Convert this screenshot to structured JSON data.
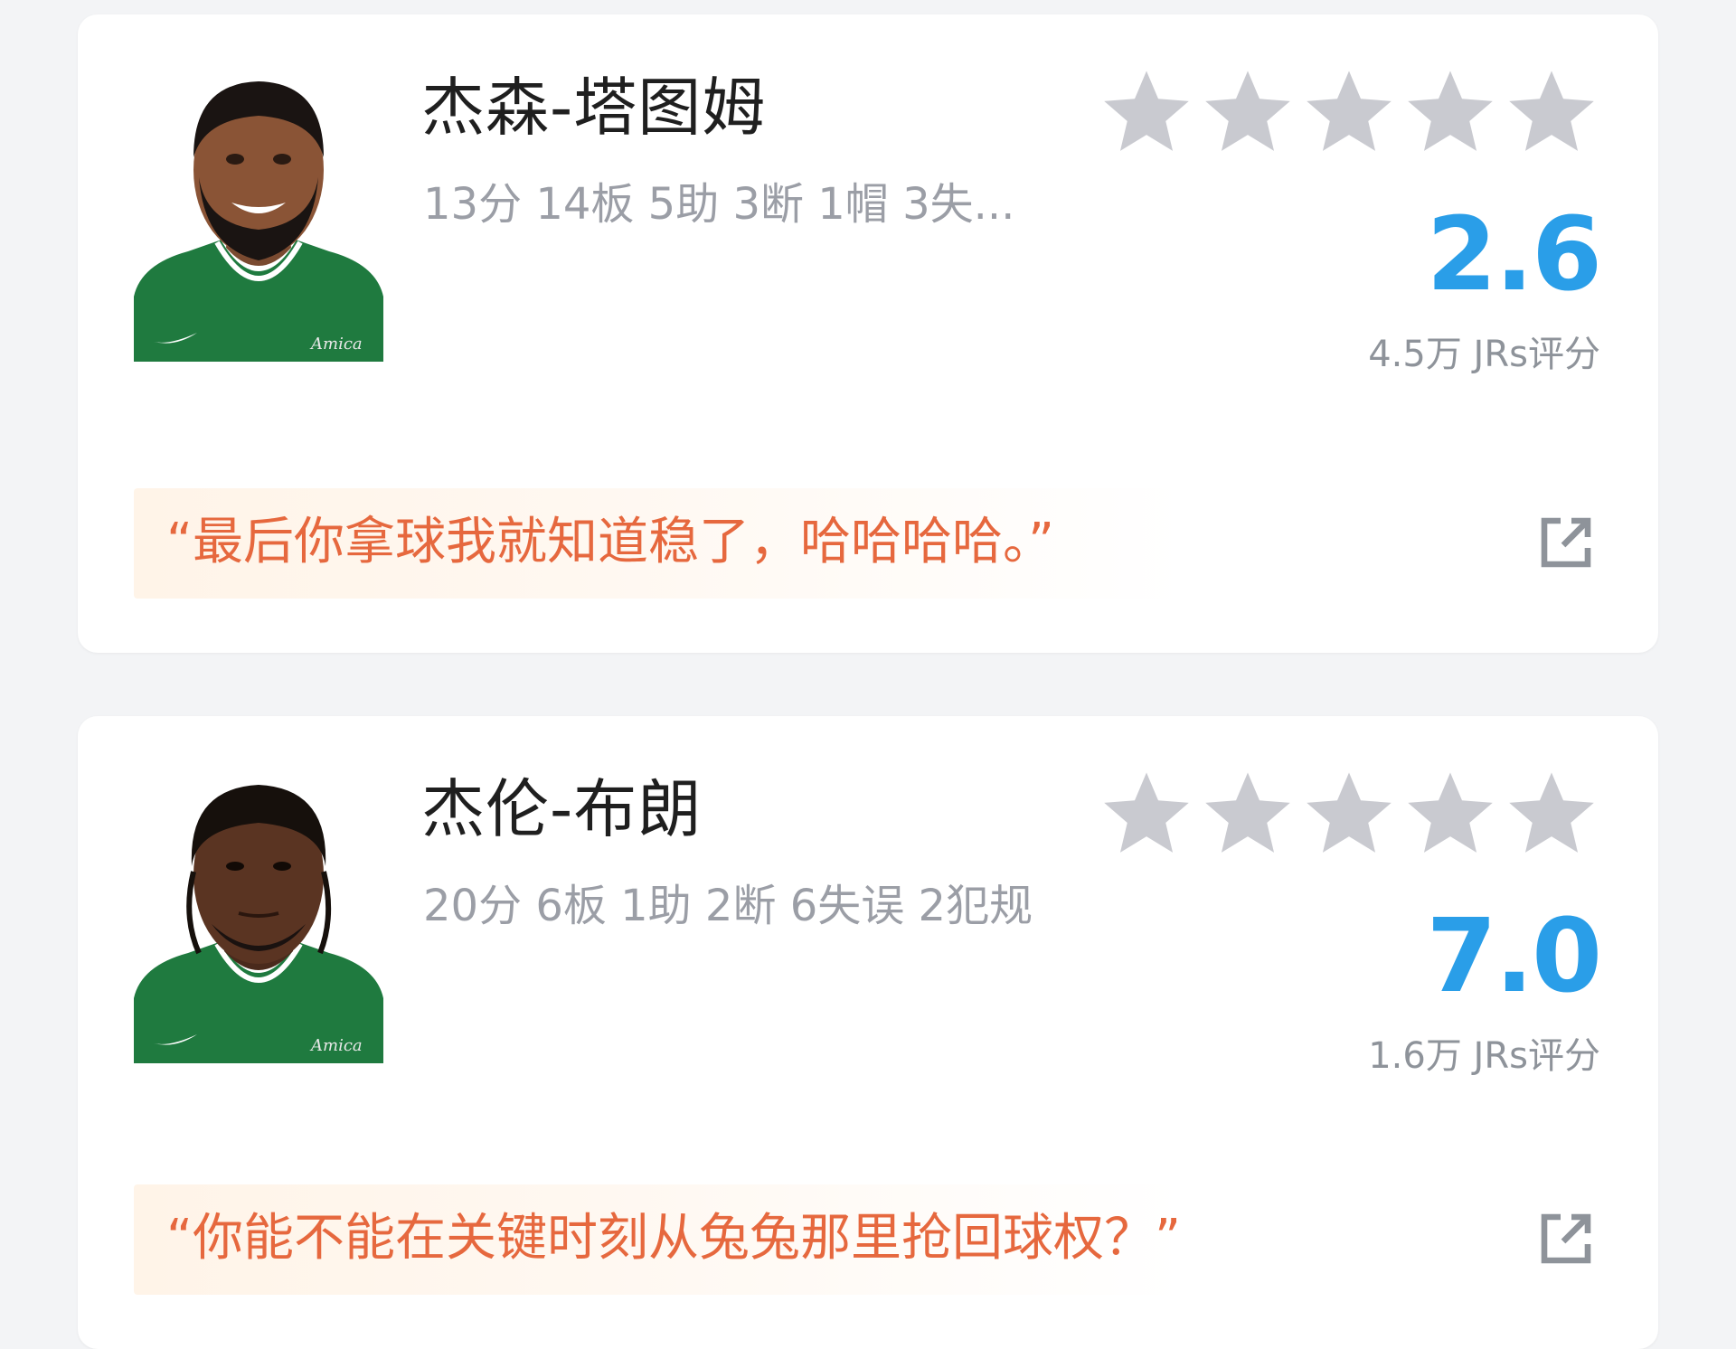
{
  "players": [
    {
      "name": "杰森-塔图姆",
      "stats": "13分 14板 5助 3断 1帽 3失...",
      "stars_filled": 0,
      "stars_total": 5,
      "score": "2.6",
      "rating_count": "4.5万 JRs评分",
      "comment": "“最后你拿球我就知道稳了，哈哈哈哈。”",
      "avatar_icon": "player-headshot",
      "jersey_text": "Amica"
    },
    {
      "name": "杰伦-布朗",
      "stats": "20分 6板 1助 2断 6失误 2犯规",
      "stars_filled": 0,
      "stars_total": 5,
      "score": "7.0",
      "rating_count": "1.6万 JRs评分",
      "comment": "“你能不能在关键时刻从兔兔那里抢回球权？”",
      "avatar_icon": "player-headshot",
      "jersey_text": "Amica"
    }
  ],
  "colors": {
    "score": "#2a9ee8",
    "comment": "#e6683e",
    "star_empty": "#c9cad0",
    "jersey": "#1f7a3f"
  }
}
